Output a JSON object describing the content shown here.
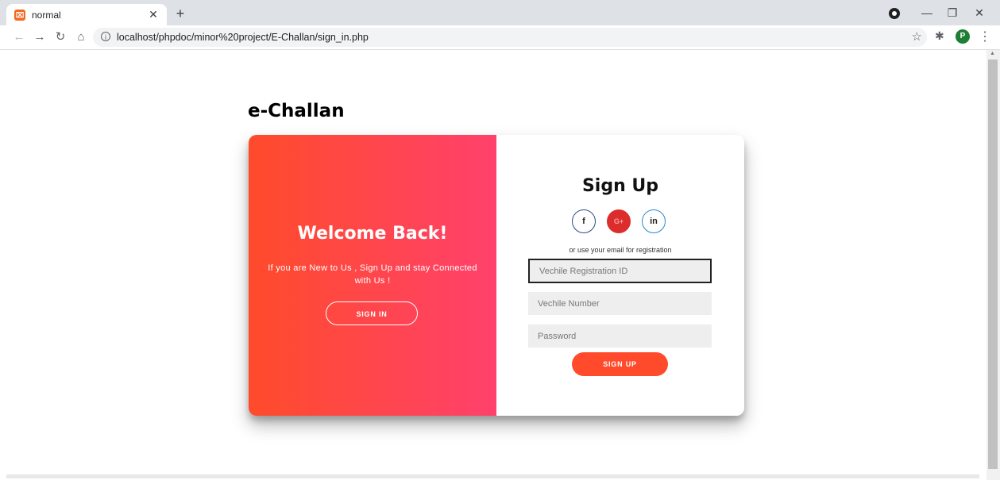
{
  "browser": {
    "tab_title": "normal",
    "tab_favicon": "xampp-icon",
    "url": "localhost/phpdoc/minor%20project/E-Challan/sign_in.php",
    "icons": {
      "back": "arrow-left-icon",
      "forward": "arrow-right-icon",
      "reload": "reload-icon",
      "home": "home-icon",
      "info": "info-icon",
      "bookmark": "star-icon",
      "extensions": "puzzle-icon",
      "menu": "menu-dots-icon"
    },
    "profile_initial": "P",
    "profile_color": "#1e7e34"
  },
  "page": {
    "brand": "e-Challan",
    "overlay": {
      "heading": "Welcome Back!",
      "text": "If you are New to Us , Sign Up and stay Connected with Us !",
      "button": "SIGN IN",
      "gradient_start": "#ff4b2b",
      "gradient_end": "#ff416c"
    },
    "form": {
      "heading": "Sign Up",
      "social": [
        {
          "label": "f",
          "icon": "facebook-icon"
        },
        {
          "label": "G+",
          "icon": "google-plus-icon"
        },
        {
          "label": "in",
          "icon": "linkedin-icon"
        }
      ],
      "hint": "or use your email for registration",
      "fields": [
        {
          "placeholder": "Vechile Registration ID",
          "value": ""
        },
        {
          "placeholder": "Vechile Number",
          "value": ""
        },
        {
          "placeholder": "Password",
          "value": ""
        }
      ],
      "submit": "SIGN UP",
      "accent": "#ff4b2b"
    }
  }
}
